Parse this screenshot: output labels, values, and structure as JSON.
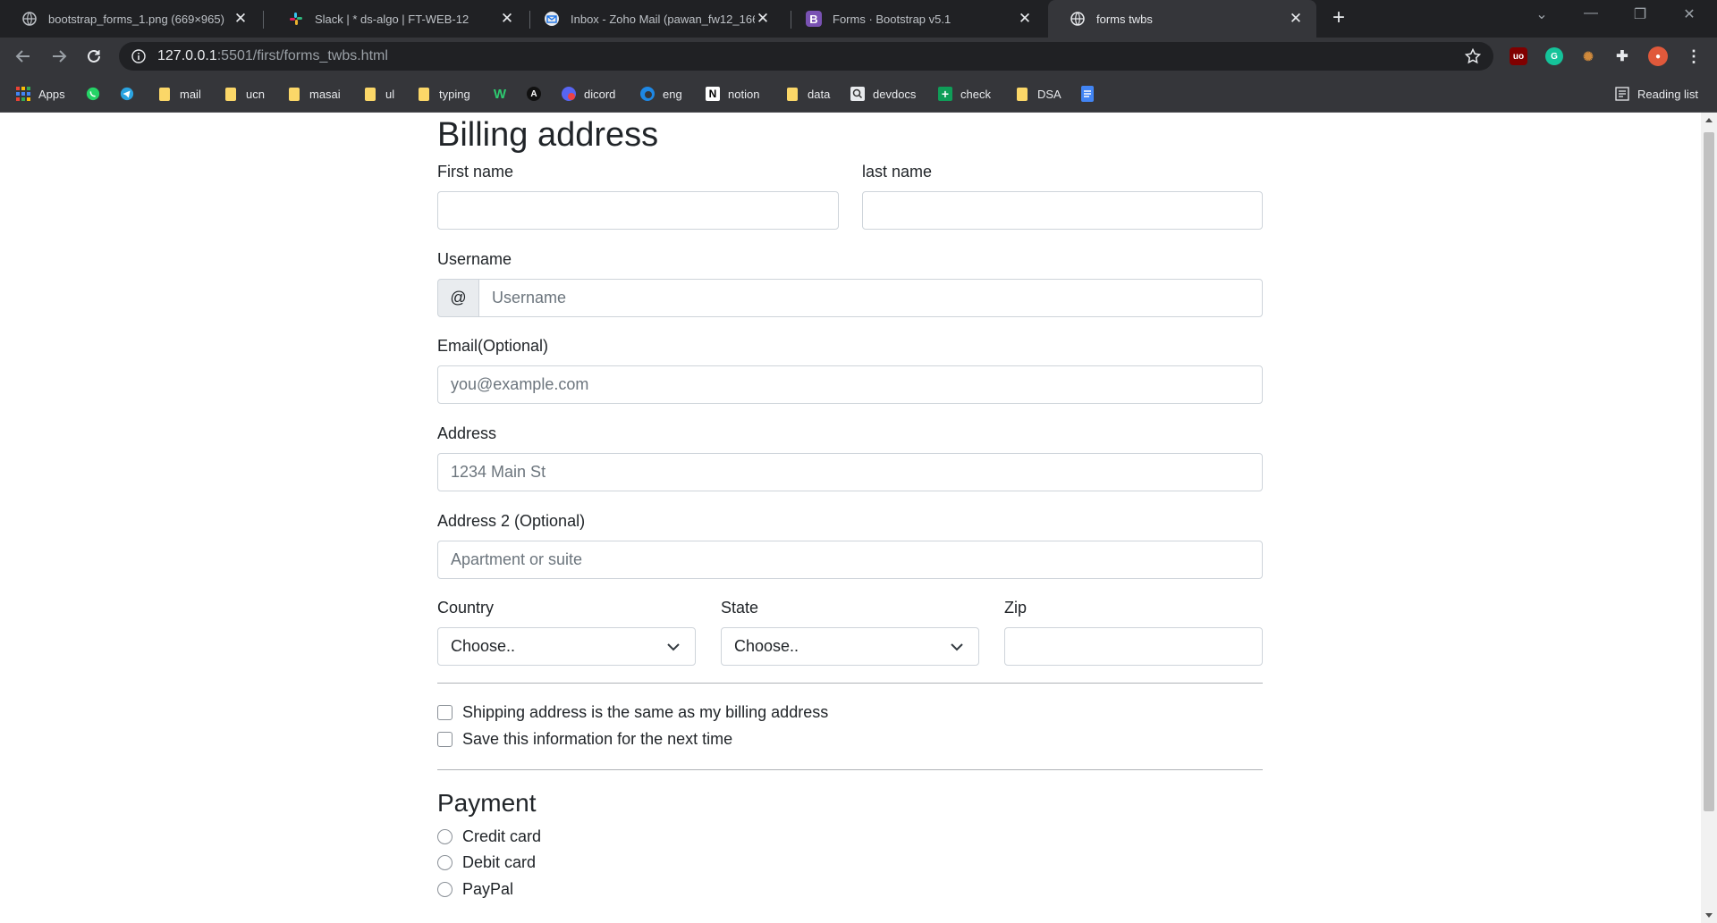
{
  "browser": {
    "tabs": [
      {
        "title": "bootstrap_forms_1.png (669×965)",
        "favicon": "globe-icon"
      },
      {
        "title": "Slack | * ds-algo | FT-WEB-12",
        "favicon": "slack-icon"
      },
      {
        "title": "Inbox - Zoho Mail (pawan_fw12_166",
        "favicon": "zoho-mail-icon"
      },
      {
        "title": "Forms · Bootstrap v5.1",
        "favicon": "bootstrap-icon"
      },
      {
        "title": "forms twbs",
        "favicon": "globe-icon"
      }
    ],
    "active_tab_index": 4,
    "url_host": "127.0.0.1",
    "url_rest": ":5501/first/forms_twbs.html",
    "bookmarks": [
      {
        "label": "Apps",
        "icon": "apps-grid-icon"
      },
      {
        "label": "",
        "icon": "whatsapp-icon"
      },
      {
        "label": "",
        "icon": "telegram-icon"
      },
      {
        "label": "mail",
        "icon": "folder-icon"
      },
      {
        "label": "ucn",
        "icon": "folder-icon"
      },
      {
        "label": "masai",
        "icon": "folder-icon"
      },
      {
        "label": "ul",
        "icon": "folder-icon"
      },
      {
        "label": "typing",
        "icon": "folder-icon"
      },
      {
        "label": "",
        "icon": "w-icon"
      },
      {
        "label": "",
        "icon": "a-icon"
      },
      {
        "label": "dicord",
        "icon": "discord-icon"
      },
      {
        "label": "eng",
        "icon": "edge-icon"
      },
      {
        "label": "notion",
        "icon": "notion-icon"
      },
      {
        "label": "data",
        "icon": "folder-icon"
      },
      {
        "label": "devdocs",
        "icon": "devdocs-icon"
      },
      {
        "label": "check",
        "icon": "plus-sheet-icon"
      },
      {
        "label": "DSA",
        "icon": "folder-icon"
      },
      {
        "label": "",
        "icon": "docs-icon"
      }
    ],
    "reading_list": "Reading list"
  },
  "form": {
    "heading": "Billing address",
    "first_name_label": "First name",
    "last_name_label": "last name",
    "username_label": "Username",
    "username_prefix": "@",
    "username_placeholder": "Username",
    "email_label": "Email(Optional)",
    "email_placeholder": "you@example.com",
    "address_label": "Address",
    "address_placeholder": "1234 Main St",
    "address2_label": "Address 2 (Optional)",
    "address2_placeholder": "Apartment or suite",
    "country_label": "Country",
    "country_selected": "Choose..",
    "state_label": "State",
    "state_selected": "Choose..",
    "zip_label": "Zip",
    "check_same_address": "Shipping address is the same as my billing address",
    "check_save_info": "Save this information for the next time"
  },
  "payment": {
    "heading": "Payment",
    "options": [
      "Credit card",
      "Debit card",
      "PayPal"
    ]
  }
}
